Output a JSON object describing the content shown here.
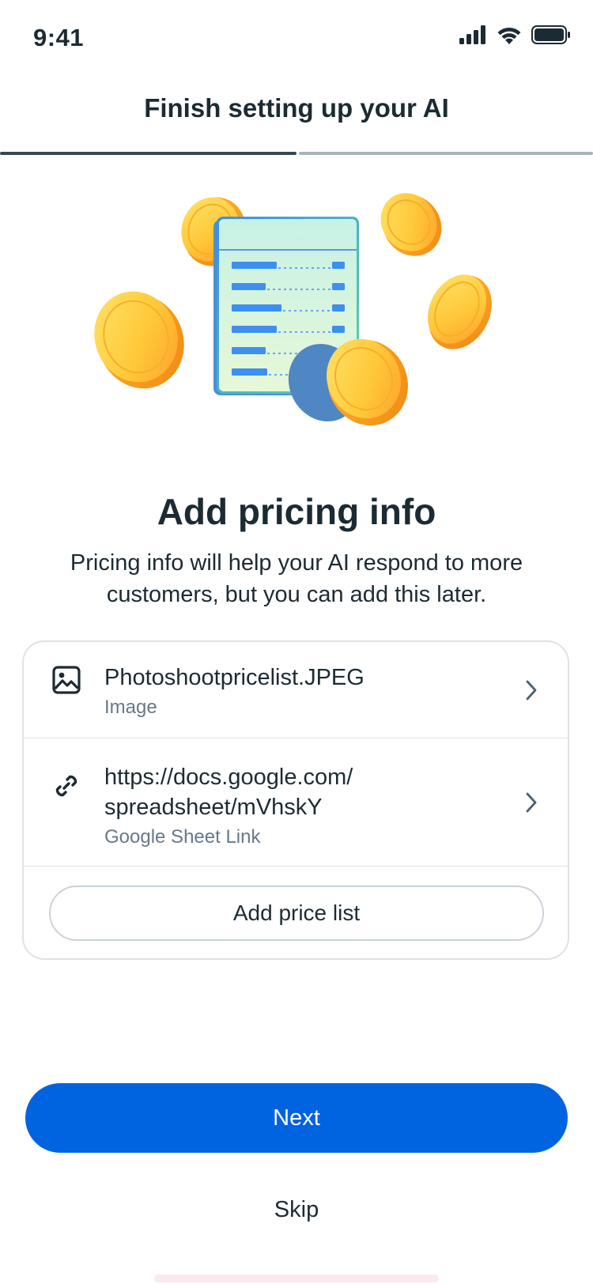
{
  "status_bar": {
    "time": "9:41",
    "icons": [
      "signal-icon",
      "wifi-icon",
      "battery-icon"
    ]
  },
  "header": {
    "title": "Finish setting up your AI",
    "progress": 0.5
  },
  "illustration": {
    "name": "price-list-with-coins"
  },
  "main": {
    "title": "Add pricing info",
    "description": "Pricing info will help your AI respond to more customers, but you can add this later."
  },
  "price_list": {
    "items": [
      {
        "icon": "image-icon",
        "primary": "Photoshootpricelist.JPEG",
        "secondary": "Image"
      },
      {
        "icon": "link-icon",
        "primary_line1": "https://docs.google.com/",
        "primary_line2": "spreadsheet/mVhskY",
        "secondary": "Google Sheet Link"
      }
    ],
    "add_button_label": "Add price list"
  },
  "actions": {
    "next_label": "Next",
    "skip_label": "Skip"
  },
  "colors": {
    "primary": "#0064e0",
    "text": "#1c2b33",
    "secondary_text": "#67788a",
    "border": "#dde3e8"
  }
}
